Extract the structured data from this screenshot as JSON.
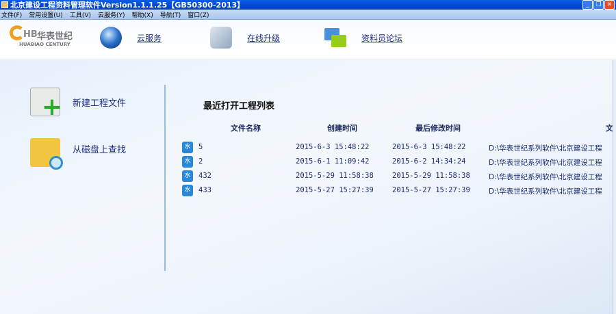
{
  "window": {
    "title": "北京建设工程资料管理软件Version1.1.1.25【GB50300-2013】"
  },
  "menu": [
    "文件(F)",
    "常用设置(U)",
    "工具(V)",
    "云服务(Y)",
    "帮助(X)",
    "导航(T)",
    "窗口(Z)"
  ],
  "logo": {
    "mark": "HB",
    "cn": "华表世纪",
    "en": "HUABIAO CENTURY"
  },
  "toolbar": {
    "cloud": "云服务",
    "upgrade": "在线升级",
    "forum": "资料员论坛"
  },
  "sidebar": {
    "new_file": "新建工程文件",
    "find_disk": "从磁盘上查找"
  },
  "recent": {
    "title": "最近打开工程列表",
    "columns": [
      "文件名称",
      "创建时间",
      "最后修改时间",
      "文"
    ],
    "rows": [
      {
        "name": "5",
        "created": "2015-6-3 15:48:22",
        "modified": "2015-6-3 15:48:22",
        "path": "D:\\华表世纪系列软件\\北京建设工程"
      },
      {
        "name": "2",
        "created": "2015-6-1 11:09:42",
        "modified": "2015-6-2 14:34:24",
        "path": "D:\\华表世纪系列软件\\北京建设工程"
      },
      {
        "name": "432",
        "created": "2015-5-29 11:58:38",
        "modified": "2015-5-29 11:58:38",
        "path": "D:\\华表世纪系列软件\\北京建设工程"
      },
      {
        "name": "433",
        "created": "2015-5-27 15:27:39",
        "modified": "2015-5-27 15:27:39",
        "path": "D:\\华表世纪系列软件\\北京建设工程"
      }
    ],
    "file_icon_glyph": "水"
  }
}
